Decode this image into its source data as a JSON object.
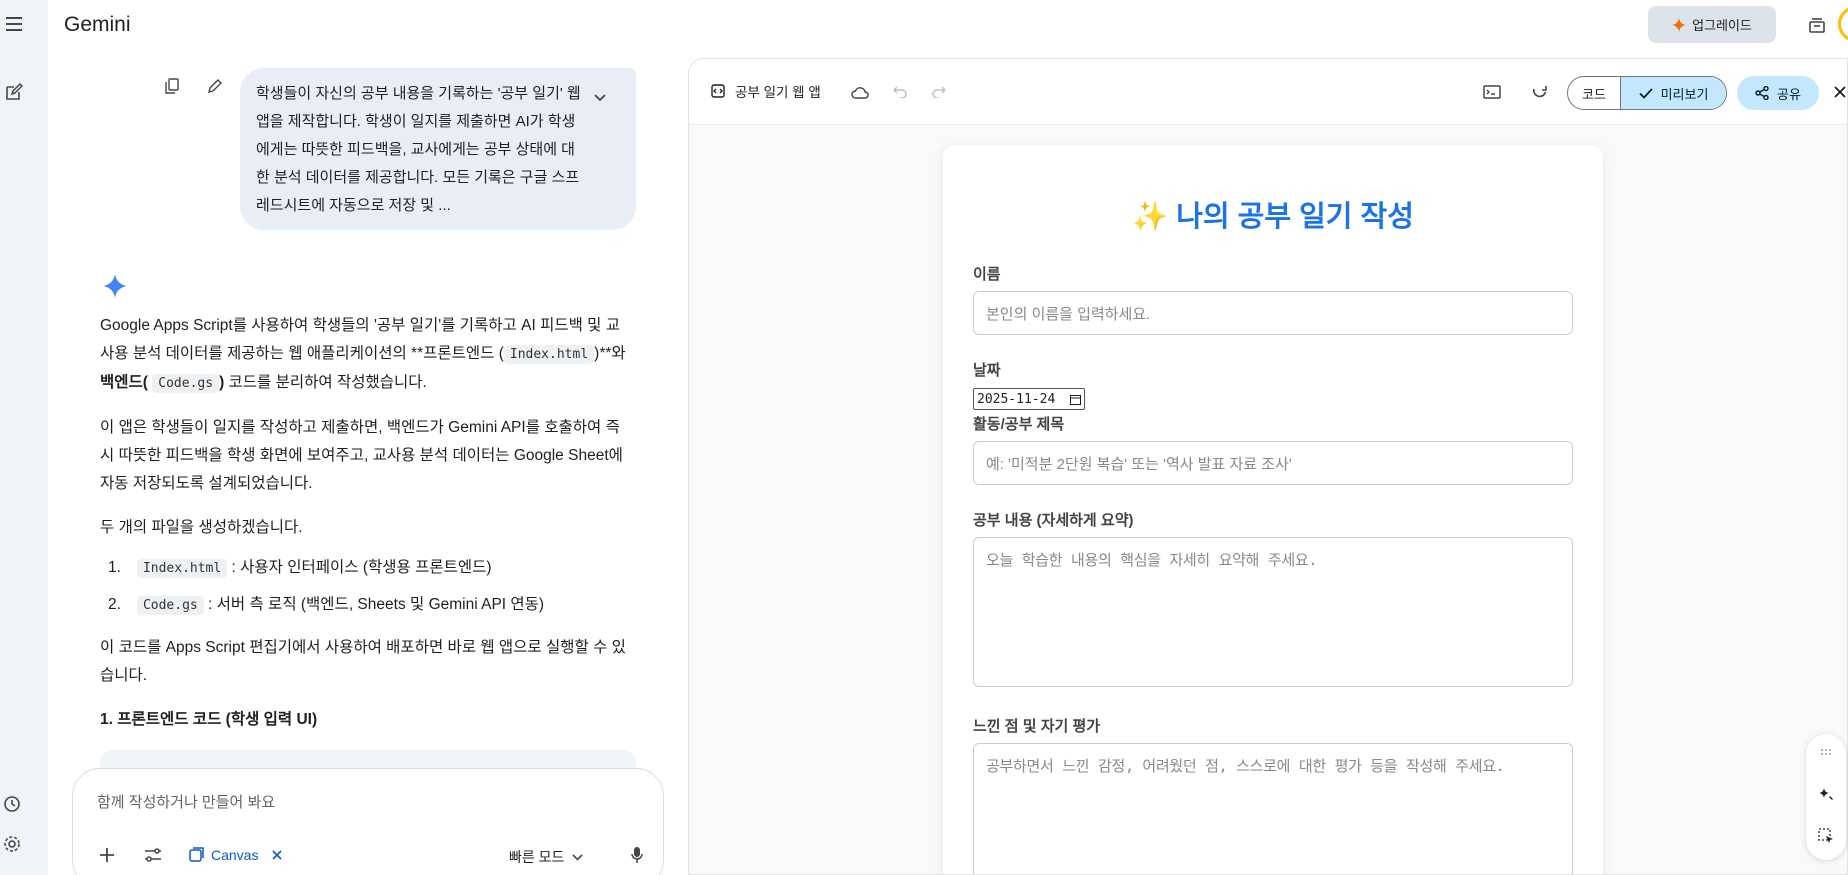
{
  "app": {
    "title": "Gemini"
  },
  "header": {
    "upgrade_label": "업그레이드"
  },
  "prompt": {
    "text": "학생들이 자신의 공부 내용을 기록하는 '공부 일기' 웹 앱을 제작합니다. 학생이 일지를 제출하면 AI가 학생에게는 따뜻한 피드백을, 교사에게는 공부 상태에 대한 분석 데이터를 제공합니다. 모든 기록은 구글 스프레드시트에 자동으로 저장 및 ..."
  },
  "response": {
    "p1_a": "Google Apps Script를 사용하여 학생들의 '공부 일기'를 기록하고 AI 피드백 및 교사용 분석 데이터를 제공하는 웹 애플리케이션의 **프론트엔드 (",
    "p1_code1": "Index.html",
    "p1_b": ")**와 ",
    "p1_bold": "백엔드(",
    "p1_code2": "Code.gs",
    "p1_bold2": ")",
    "p1_c": " 코드를 분리하여 작성했습니다.",
    "p2": "이 앱은 학생들이 일지를 작성하고 제출하면, 백엔드가 Gemini API를 호출하여 즉시 따뜻한 피드백을 학생 화면에 보여주고, 교사용 분석 데이터는 Google Sheet에 자동 저장되도록 설계되었습니다.",
    "p3": "두 개의 파일을 생성하겠습니다.",
    "list": [
      {
        "num": "1.",
        "code": "Index.html",
        "desc": ": 사용자 인터페이스 (학생용 프론트엔드)"
      },
      {
        "num": "2.",
        "code": "Code.gs",
        "desc": ": 서버 측 로직 (백엔드, Sheets 및 Gemini API 연동)"
      }
    ],
    "p4": "이 코드를 Apps Script 편집기에서 사용하여 배포하면 바로 웹 앱으로 실행할 수 있습니다.",
    "section_heading": "1. 프론트엔드 코드 (학생 입력 UI)"
  },
  "chat_input": {
    "placeholder": "함께 작성하거나 만들어 봐요",
    "canvas_label": "Canvas",
    "mode_label": "빠른 모드"
  },
  "canvas": {
    "title": "공부 일기 웹 앱",
    "code_tab": "코드",
    "preview_tab": "미리보기",
    "share_label": "공유"
  },
  "form": {
    "title_emoji": "✨",
    "title": "나의 공부 일기 작성",
    "name_label": "이름",
    "name_placeholder": "본인의 이름을 입력하세요.",
    "date_label": "날짜",
    "date_value": "2025-11-24",
    "activity_label": "활동/공부 제목",
    "activity_placeholder": "예: '미적분 2단원 복습' 또는 '역사 발표 자료 조사'",
    "content_label": "공부 내용 (자세하게 요약)",
    "content_placeholder": "오늘 학습한 내용의 핵심을 자세히 요약해 주세요.",
    "reflection_label": "느낀 점 및 자기 평가",
    "reflection_placeholder": "공부하면서 느낀 감정, 어려웠던 점, 스스로에 대한 평가 등을 작성해 주세요."
  },
  "colors": {
    "accent": "#1a73e8",
    "chip": "#c2e7ff",
    "bubble": "#e9eef6"
  }
}
